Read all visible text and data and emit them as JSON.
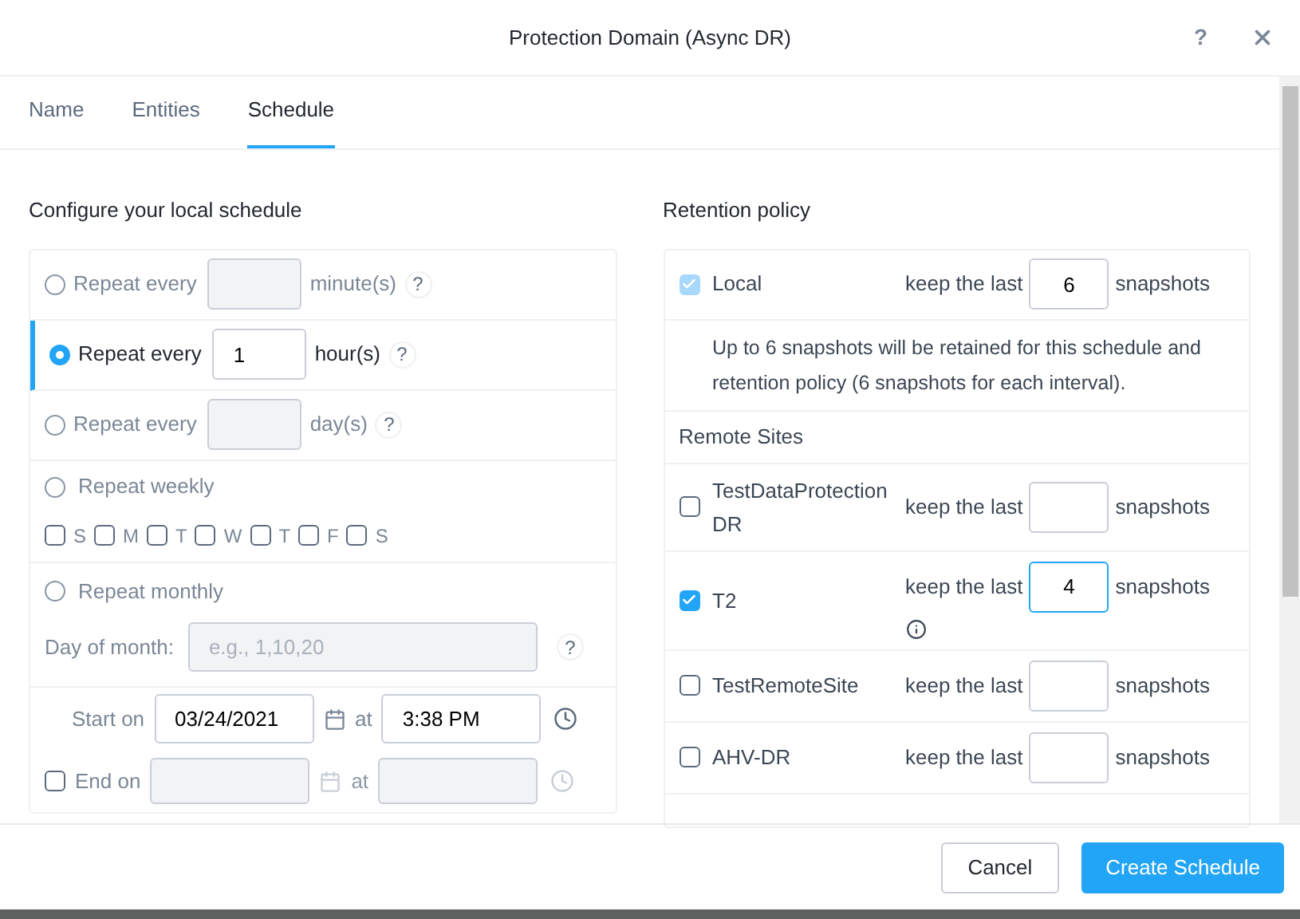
{
  "window": {
    "title": "Protection Domain (Async DR)",
    "help": "?"
  },
  "tabs": [
    {
      "label": "Name",
      "selected": false
    },
    {
      "label": "Entities",
      "selected": false
    },
    {
      "label": "Schedule",
      "selected": true
    }
  ],
  "schedule": {
    "heading": "Configure your local schedule",
    "options": [
      {
        "kind": "interval",
        "label": "Repeat every",
        "unit": "minute(s)",
        "help": "?",
        "selected": false
      },
      {
        "kind": "interval",
        "label": "Repeat every",
        "value": "1",
        "unit": "hour(s)",
        "help": "?",
        "selected": true
      },
      {
        "kind": "interval",
        "label": "Repeat every",
        "unit": "day(s)",
        "help": "?",
        "selected": false
      },
      {
        "kind": "weekly",
        "label": "Repeat weekly",
        "selected": false,
        "days": [
          {
            "label": "S",
            "checked": false
          },
          {
            "label": "M",
            "checked": false
          },
          {
            "label": "T",
            "checked": false
          },
          {
            "label": "W",
            "checked": false
          },
          {
            "label": "T",
            "checked": false
          },
          {
            "label": "F",
            "checked": false
          },
          {
            "label": "S",
            "checked": false
          }
        ]
      },
      {
        "kind": "monthly",
        "label": "Repeat monthly",
        "selected": false,
        "field_label": "Day of month:",
        "placeholder": "e.g., 1,10,20",
        "help": "?"
      }
    ],
    "start": {
      "label": "Start on",
      "date": "03/24/2021",
      "at": "at",
      "time": "3:38 PM"
    },
    "end": {
      "label": "End on",
      "checked": false,
      "at": "at"
    }
  },
  "retention": {
    "heading": "Retention policy",
    "local": {
      "label": "Local",
      "checked": true,
      "keep": "keep the last",
      "value": "6",
      "unit": "snapshots",
      "note": "Up to 6 snapshots will be retained for this schedule and retention policy (6 snapshots for each interval)."
    },
    "remote_heading": "Remote Sites",
    "sites": [
      {
        "name": "TestDataProtection DR",
        "checked": false,
        "keep": "keep the last",
        "unit": "snapshots",
        "focused": false,
        "info": false
      },
      {
        "name": "T2",
        "checked": true,
        "keep": "keep the last",
        "value": "4",
        "unit": "snapshots",
        "focused": true,
        "info": true
      },
      {
        "name": "TestRemoteSite",
        "checked": false,
        "keep": "keep the last",
        "unit": "snapshots",
        "focused": false,
        "info": false
      },
      {
        "name": "AHV-DR",
        "checked": false,
        "keep": "keep the last",
        "unit": "snapshots",
        "focused": false,
        "info": false
      }
    ]
  },
  "buttons": [
    {
      "label": "Cancel",
      "kind": "secondary"
    },
    {
      "label": "Create Schedule",
      "kind": "primary"
    }
  ]
}
